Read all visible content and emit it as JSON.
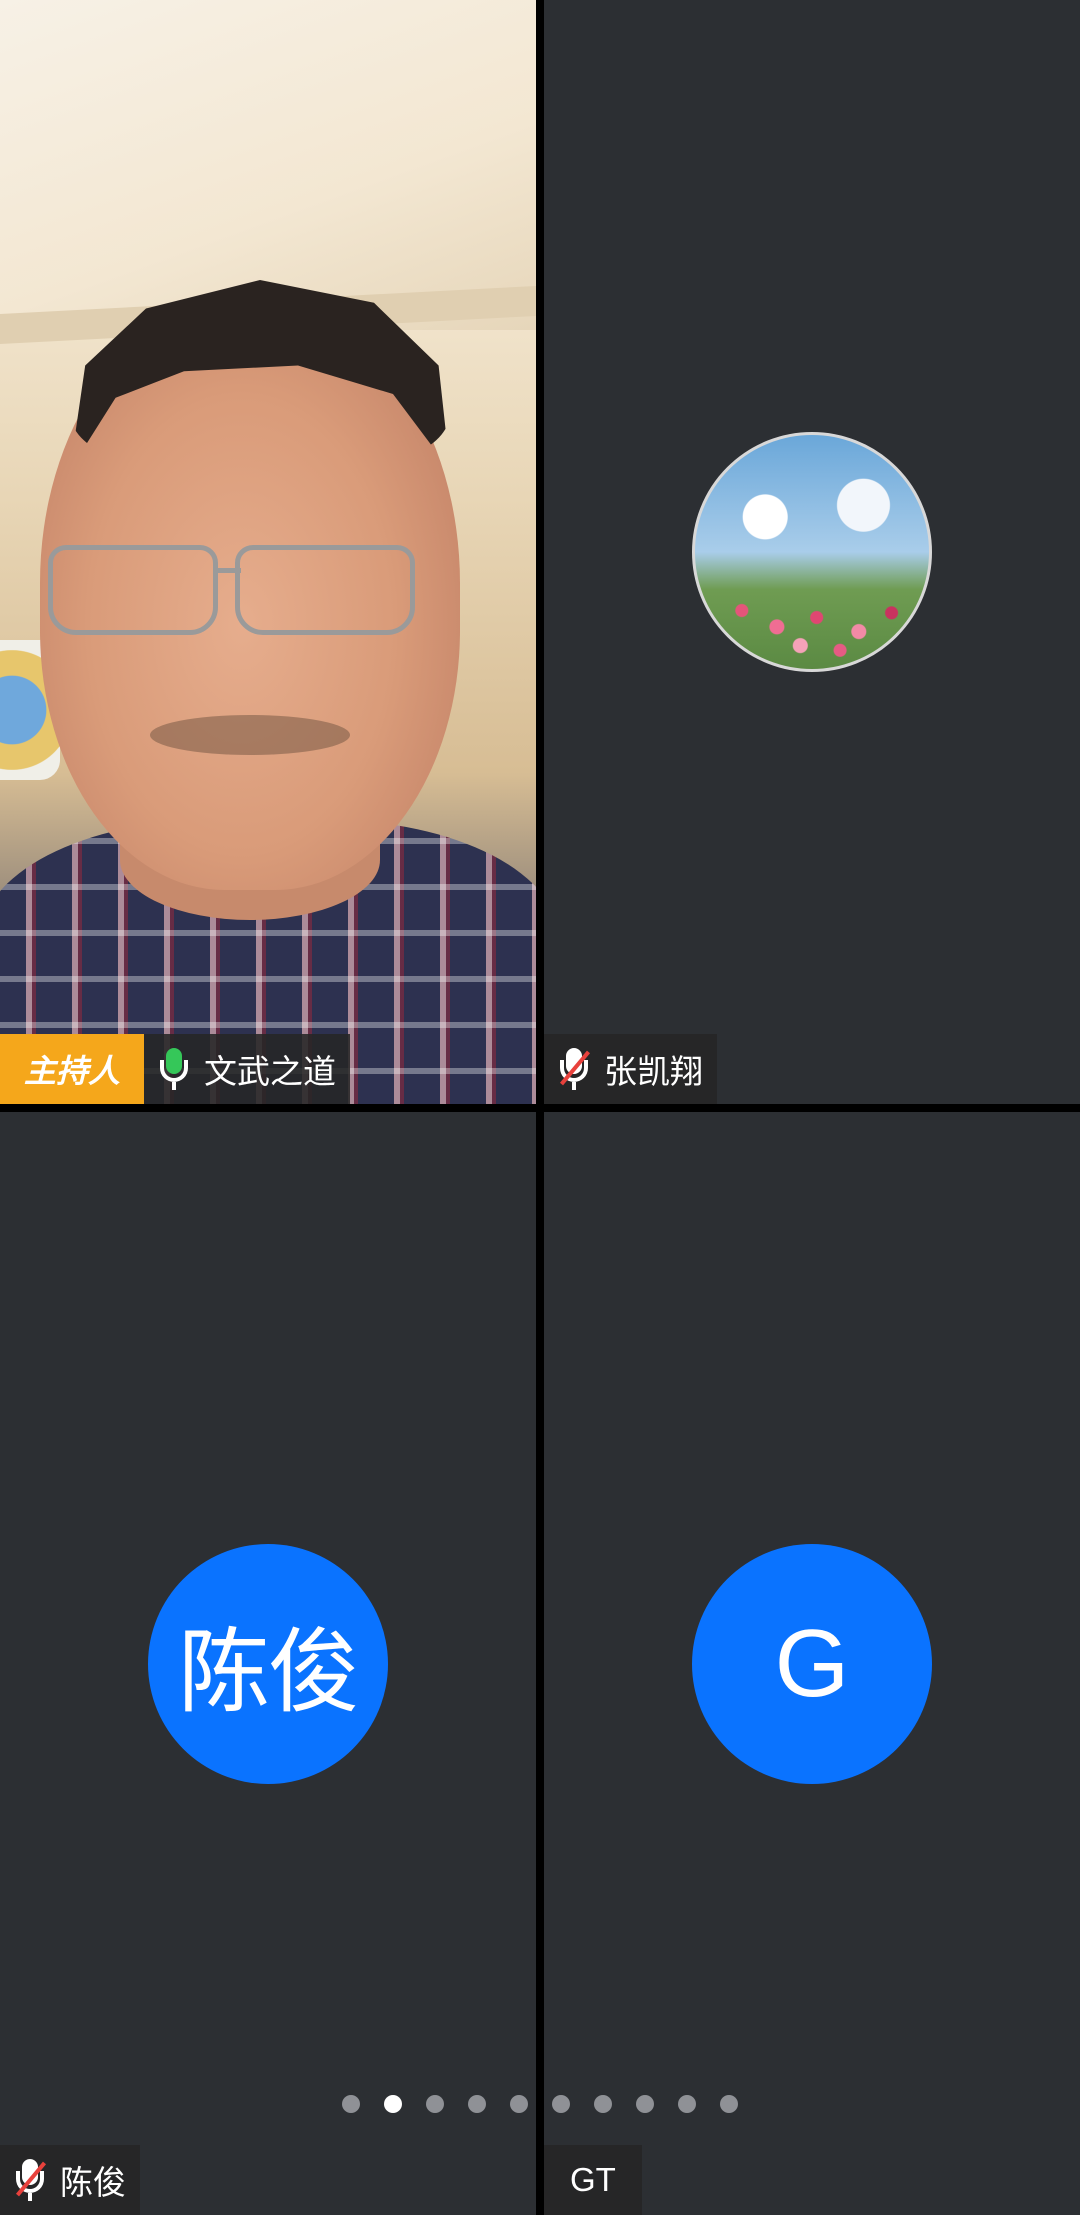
{
  "participants": [
    {
      "name": "文武之道",
      "role_badge": "主持人",
      "mic": "on",
      "view": "video"
    },
    {
      "name": "张凯翔",
      "mic": "muted",
      "view": "photo-avatar"
    },
    {
      "name": "陈俊",
      "mic": "muted",
      "view": "initials-avatar",
      "avatar_text": "陈俊",
      "avatar_color": "#0a73ff"
    },
    {
      "name": "GT",
      "view": "initials-avatar",
      "avatar_text": "G",
      "avatar_color": "#0a73ff"
    }
  ],
  "pager": {
    "total_pages": 10,
    "current_page": 2
  },
  "colors": {
    "tile_background": "#2c2f33",
    "host_badge": "#f5a71b",
    "mic_active": "#35c759",
    "mic_muted_slash": "#e8413c"
  },
  "icons": {
    "mic_on": "microphone-icon",
    "mic_muted": "microphone-muted-icon"
  }
}
